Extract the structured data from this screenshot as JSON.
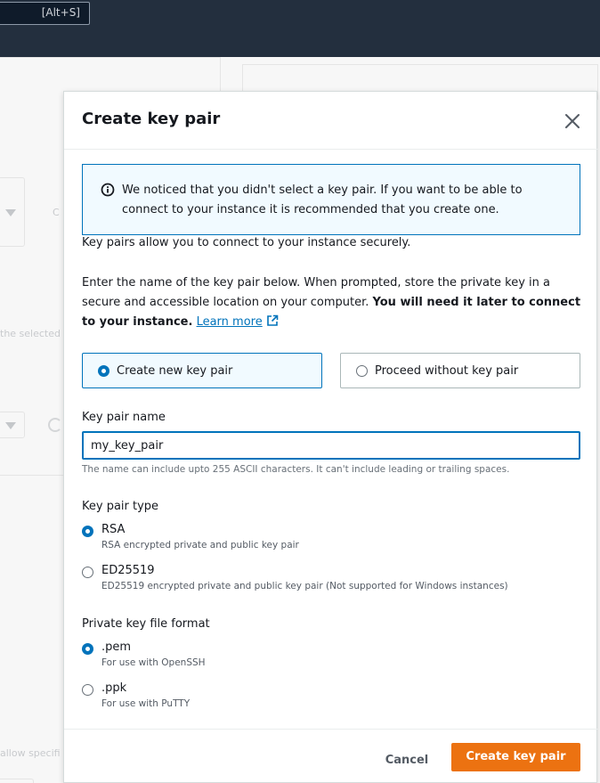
{
  "topbar": {
    "search_shortcut": "[Alt+S]"
  },
  "background": {
    "text_selected_fragment": "the selected",
    "text_c_fragment": "C",
    "text_allow_fragment": "allow specifi"
  },
  "modal": {
    "title": "Create key pair",
    "info": "We noticed that you didn't select a key pair. If you want to be able to connect to your instance it is recommended that you create one.",
    "description1": "Key pairs allow you to connect to your instance securely.",
    "description2_prefix": "Enter the name of the key pair below. When prompted, store the private key in a secure and accessible location on your computer. ",
    "description2_bold": "You will need it later to connect to your instance.",
    "learn_more": "Learn more",
    "options": {
      "create_new": "Create new key pair",
      "proceed_without": "Proceed without key pair",
      "selected": "create_new"
    },
    "key_pair_name": {
      "label": "Key pair name",
      "value": "my_key_pair",
      "hint": "The name can include upto 255 ASCII characters. It can't include leading or trailing spaces."
    },
    "key_pair_type": {
      "label": "Key pair type",
      "options": [
        {
          "label": "RSA",
          "description": "RSA encrypted private and public key pair",
          "checked": true
        },
        {
          "label": "ED25519",
          "description": "ED25519 encrypted private and public key pair (Not supported for Windows instances)",
          "checked": false
        }
      ]
    },
    "private_key_format": {
      "label": "Private key file format",
      "options": [
        {
          "label": ".pem",
          "description": "For use with OpenSSH",
          "checked": true
        },
        {
          "label": ".ppk",
          "description": "For use with PuTTY",
          "checked": false
        }
      ]
    },
    "cancel": "Cancel",
    "create": "Create key pair"
  },
  "colors": {
    "accent": "#0073bb",
    "primary_button": "#ec7211",
    "topbar": "#232f3e"
  }
}
